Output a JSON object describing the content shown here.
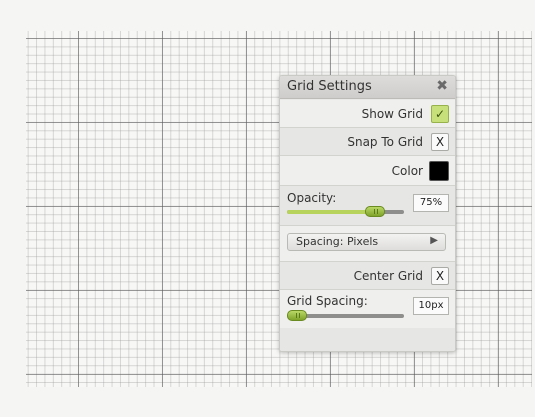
{
  "panel": {
    "title": "Grid Settings",
    "close_icon": "close-icon"
  },
  "show_grid": {
    "label": "Show Grid",
    "checked": true,
    "mark": "✓"
  },
  "snap_to_grid": {
    "label": "Snap To Grid",
    "checked": false,
    "mark": "X"
  },
  "color": {
    "label": "Color",
    "value": "#000000"
  },
  "opacity": {
    "label": "Opacity:",
    "value_text": "75%",
    "value": 0.75
  },
  "spacing_select": {
    "selected": "Spacing: Pixels",
    "arrow_icon": "play-arrow-icon"
  },
  "center_grid": {
    "label": "Center Grid",
    "checked": false,
    "mark": "X"
  },
  "grid_spacing": {
    "label": "Grid Spacing:",
    "value_text": "10px",
    "value": 0.08
  },
  "colors": {
    "accent": "#b8d35c",
    "panel_bg": "#e9e9e7"
  }
}
